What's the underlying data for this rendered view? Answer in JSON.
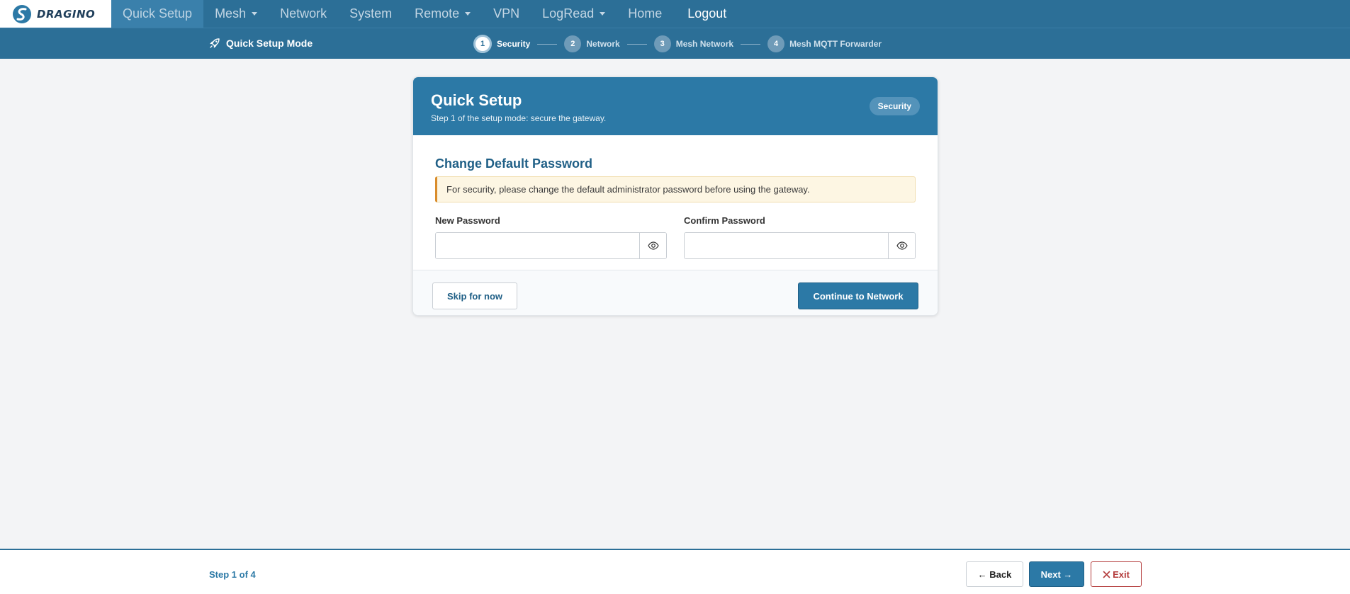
{
  "brand": {
    "name": "DRAGINO"
  },
  "nav": {
    "items": [
      {
        "label": "Quick Setup",
        "dropdown": false,
        "active": true
      },
      {
        "label": "Mesh",
        "dropdown": true
      },
      {
        "label": "Network",
        "dropdown": false
      },
      {
        "label": "System",
        "dropdown": false
      },
      {
        "label": "Remote",
        "dropdown": true
      },
      {
        "label": "VPN",
        "dropdown": false
      },
      {
        "label": "LogRead",
        "dropdown": true
      },
      {
        "label": "Home",
        "dropdown": false
      }
    ],
    "logout_label": "Logout"
  },
  "stepper": {
    "mode_label": "Quick Setup Mode",
    "mode_icon": "rocket-icon",
    "current_step": 1,
    "steps": [
      {
        "number": "1",
        "label": "Security"
      },
      {
        "number": "2",
        "label": "Network"
      },
      {
        "number": "3",
        "label": "Mesh Network"
      },
      {
        "number": "4",
        "label": "Mesh MQTT Forwarder"
      }
    ]
  },
  "card": {
    "title": "Quick Setup",
    "subtitle": "Step 1 of the setup mode: secure the gateway.",
    "badge": "Security",
    "section_title": "Change Default Password",
    "alert": "For security, please change the default administrator password before using the gateway.",
    "fields": {
      "new_password": {
        "label": "New Password",
        "value": "",
        "placeholder": ""
      },
      "confirm_password": {
        "label": "Confirm Password",
        "value": "",
        "placeholder": ""
      }
    },
    "skip_label": "Skip for now",
    "continue_label": "Continue to Network"
  },
  "footer": {
    "step_count": "Step 1 of 4",
    "back_label": "← Back",
    "next_label": "Next →",
    "exit_label": "Exit"
  },
  "colors": {
    "primary": "#2c6f97",
    "accent": "#2c79a6",
    "warning_border": "#d98c2b",
    "danger": "#b33a3a"
  }
}
